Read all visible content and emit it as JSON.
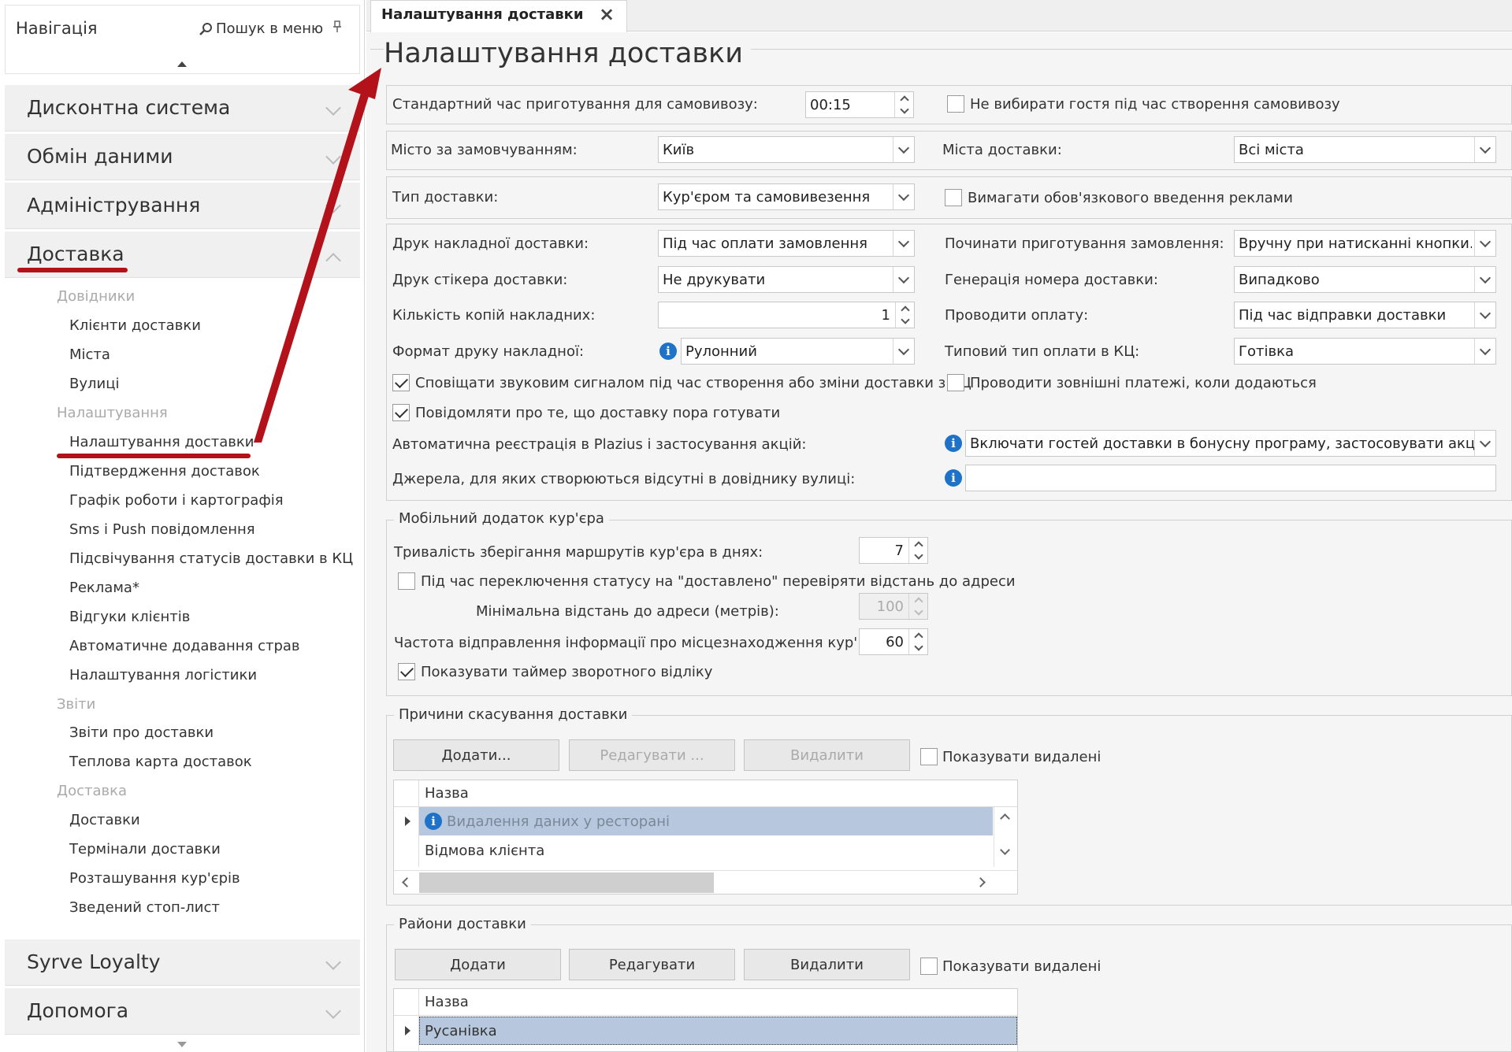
{
  "nav": {
    "title": "Навігація",
    "search_label": "Пошук в меню",
    "groups_top": [
      {
        "label": "Дисконтна система"
      },
      {
        "label": "Обмін даними"
      },
      {
        "label": "Адміністрування"
      }
    ],
    "open_group": {
      "label": "Доставка",
      "sections": [
        {
          "title": "Довідники",
          "items": [
            "Клієнти доставки",
            "Міста",
            "Вулиці"
          ]
        },
        {
          "title": "Налаштування",
          "items": [
            "Налаштування доставки",
            "Підтвердження доставок",
            "Графік роботи і картографія",
            "Sms і Push повідомлення",
            "Підсвічування статусів доставки в КЦ",
            "Реклама*",
            "Відгуки клієнтів",
            "Автоматичне додавання страв",
            "Налаштування логістики"
          ]
        },
        {
          "title": "Звіти",
          "items": [
            "Звіти про доставки",
            "Теплова карта доставок"
          ]
        },
        {
          "title": "Доставка",
          "items": [
            "Доставки",
            "Термінали доставки",
            "Розташування кур'єрів",
            "Зведений стоп-лист"
          ]
        }
      ]
    },
    "groups_bottom": [
      {
        "label": "Syrve Loyalty"
      },
      {
        "label": "Допомога"
      }
    ]
  },
  "tab": {
    "label": "Налаштування доставки"
  },
  "page_title": "Налаштування доставки",
  "form": {
    "prep_time_label": "Стандартний час приготування для самовивозу:",
    "prep_time_value": "00:15",
    "no_guest_pickup_label": "Не вибирати гостя під час створення самовивозу",
    "default_city_label": "Місто за замовчуванням:",
    "default_city_value": "Київ",
    "delivery_cities_label": "Міста доставки:",
    "delivery_cities_value": "Всі міста",
    "delivery_type_label": "Тип доставки:",
    "delivery_type_value": "Кур'єром та самовивезення",
    "require_ad_label": "Вимагати обов'язкового введення реклами",
    "print_invoice_label": "Друк накладної доставки:",
    "print_invoice_value": "Під час оплати замовлення",
    "start_cooking_label": "Починати приготування замовлення:",
    "start_cooking_value": "Вручну при натисканні кнопки...",
    "print_sticker_label": "Друк стікера доставки:",
    "print_sticker_value": "Не друкувати",
    "number_gen_label": "Генерація номера доставки:",
    "number_gen_value": "Випадково",
    "copies_label": "Кількість копій накладних:",
    "copies_value": "1",
    "payment_label": "Проводити оплату:",
    "payment_value": "Під час відправки доставки",
    "print_format_label": "Формат друку накладної:",
    "print_format_value": "Рулонний",
    "default_pay_type_label": "Типовий тип оплати в КЦ:",
    "default_pay_type_value": "Готівка",
    "sound_notify_label": "Сповіщати звуковим сигналом під час створення або зміни доставки з КЦ",
    "external_payments_label": "Проводити зовнішні платежі, коли додаються",
    "cook_notify_label": "Повідомляти про те, що доставку пора готувати",
    "plazius_label": "Автоматична реєстрація в Plazius і застосування акцій:",
    "plazius_value": "Включати гостей доставки в бонусну програму, застосовувати акції",
    "sources_label": "Джерела, для яких створюються відсутні в довіднику вулиці:",
    "sources_value": ""
  },
  "mobile": {
    "legend": "Мобільний додаток кур'єра",
    "route_days_label": "Тривалість зберігання маршрутів кур'єра в днях:",
    "route_days_value": "7",
    "check_distance_label": "Під час переключення статусу на \"доставлено\" перевіряти відстань до адреси",
    "min_distance_label": "Мінімальна відстань до адреси (метрів):",
    "min_distance_value": "100",
    "freq_label": "Частота відправлення інформації про місцезнаходження кур'єра (се",
    "freq_value": "60",
    "timer_label": "Показувати таймер зворотного відліку"
  },
  "cancel": {
    "legend": "Причини скасування доставки",
    "add": "Додати...",
    "edit": "Редагувати ...",
    "delete": "Видалити",
    "show_deleted": "Показувати видалені",
    "col_name": "Назва",
    "rows": [
      "Видалення даних у ресторані",
      "Відмова клієнта"
    ]
  },
  "districts": {
    "legend": "Райони доставки",
    "add": "Додати",
    "edit": "Редагувати",
    "delete": "Видалити",
    "show_deleted": "Показувати видалені",
    "col_name": "Назва",
    "rows": [
      "Русанівка"
    ]
  }
}
